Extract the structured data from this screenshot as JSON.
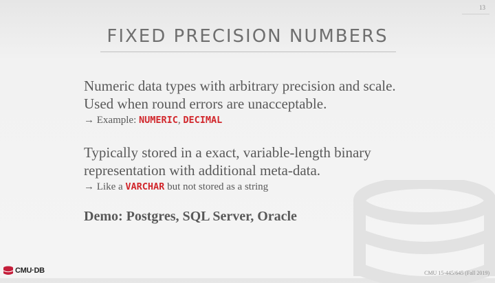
{
  "slide": {
    "page_number": "13",
    "title": "FIXED PRECISION NUMBERS",
    "points": [
      {
        "text": "Numeric data types with arbitrary precision and scale. Used when round errors are unacceptable.",
        "sub_prefix": "→ Example: ",
        "sub_code_1": "NUMERIC",
        "sub_sep": ", ",
        "sub_code_2": "DECIMAL"
      },
      {
        "text": "Typically stored in a exact, variable-length binary representation with additional meta-data.",
        "sub_prefix": "→ Like a ",
        "sub_code_1": "VARCHAR",
        "sub_suffix": " but not stored as a string"
      }
    ],
    "demo": "Demo: Postgres, SQL Server, Oracle",
    "logo_text": "CMU·DB",
    "footer": "CMU 15-445/645 (Fall 2019)"
  },
  "colors": {
    "accent_red": "#d1262b",
    "body_text": "#595959",
    "title_text": "#6f6f6f",
    "logo_red": "#c41e3a"
  },
  "icons": {
    "watermark": "database-cylinder-icon",
    "logo": "database-logo-icon"
  }
}
